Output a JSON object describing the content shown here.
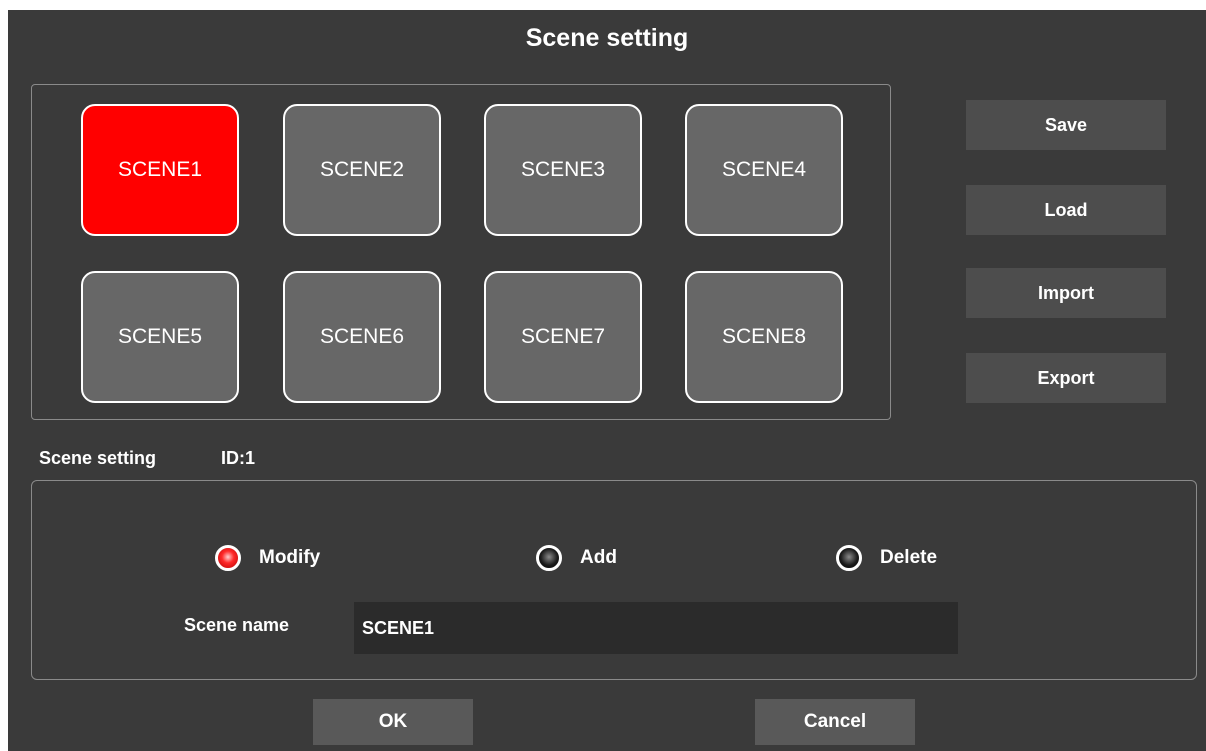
{
  "dialog": {
    "title": "Scene setting"
  },
  "scenes": [
    {
      "label": "SCENE1",
      "active": true
    },
    {
      "label": "SCENE2",
      "active": false
    },
    {
      "label": "SCENE3",
      "active": false
    },
    {
      "label": "SCENE4",
      "active": false
    },
    {
      "label": "SCENE5",
      "active": false
    },
    {
      "label": "SCENE6",
      "active": false
    },
    {
      "label": "SCENE7",
      "active": false
    },
    {
      "label": "SCENE8",
      "active": false
    }
  ],
  "side_buttons": {
    "save": "Save",
    "load": "Load",
    "import": "Import",
    "export": "Export"
  },
  "settings": {
    "caption": "Scene setting",
    "id_label": "ID:1",
    "modes": [
      {
        "label": "Modify",
        "selected": true
      },
      {
        "label": "Add",
        "selected": false
      },
      {
        "label": "Delete",
        "selected": false
      }
    ],
    "name_label": "Scene name",
    "name_value": "SCENE1"
  },
  "footer": {
    "ok": "OK",
    "cancel": "Cancel"
  },
  "colors": {
    "active_scene": "#ff0000",
    "background": "#3a3a3a",
    "scene_button": "#676767"
  }
}
